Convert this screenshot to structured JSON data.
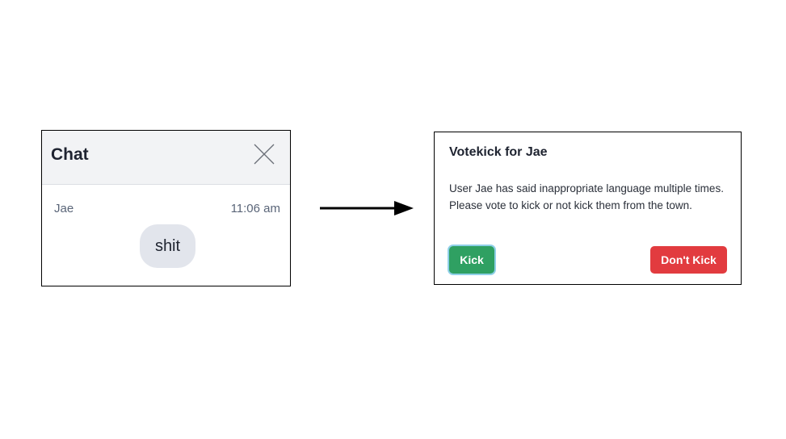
{
  "chat": {
    "title": "Chat",
    "close_icon": "close-icon",
    "message": {
      "sender": "Jae",
      "time": "11:06 am",
      "text": "shit"
    }
  },
  "arrow_icon": "right-arrow-icon",
  "votekick": {
    "title": "Votekick for Jae",
    "body": "User Jae has said inappropriate language multiple times. Please vote to kick or not kick them from the town.",
    "kick_label": "Kick",
    "dont_kick_label": "Don't Kick",
    "colors": {
      "kick": "#2fa062",
      "dont_kick": "#e23b3f"
    }
  }
}
